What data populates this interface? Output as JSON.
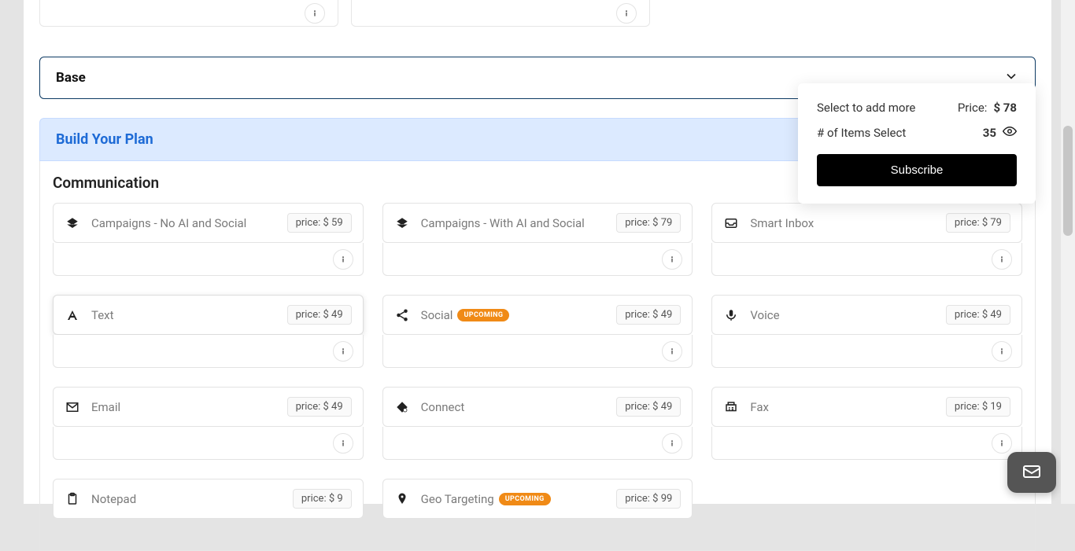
{
  "accordion": {
    "title": "Base"
  },
  "build": {
    "title": "Build Your Plan"
  },
  "section": {
    "communication": "Communication"
  },
  "price_prefix": "price: $ ",
  "badge_upcoming": "UPCOMING",
  "items": {
    "camp_noai": {
      "title": "Campaigns - No AI and Social",
      "price": "59"
    },
    "camp_ai": {
      "title": "Campaigns - With AI and Social",
      "price": "79"
    },
    "smart_inbox": {
      "title": "Smart Inbox",
      "price": "79"
    },
    "text": {
      "title": "Text",
      "price": "49"
    },
    "social": {
      "title": "Social",
      "price": "49"
    },
    "voice": {
      "title": "Voice",
      "price": "49"
    },
    "email": {
      "title": "Email",
      "price": "49"
    },
    "connect": {
      "title": "Connect",
      "price": "49"
    },
    "fax": {
      "title": "Fax",
      "price": "19"
    },
    "notepad": {
      "title": "Notepad",
      "price": "9"
    },
    "geo": {
      "title": "Geo Targeting",
      "price": "99"
    }
  },
  "summary": {
    "select_more": "Select to add more",
    "price_label": "Price: ",
    "price_value": "$ 78",
    "items_label": "# of Items Select",
    "items_count": "35",
    "subscribe": "Subscribe"
  }
}
